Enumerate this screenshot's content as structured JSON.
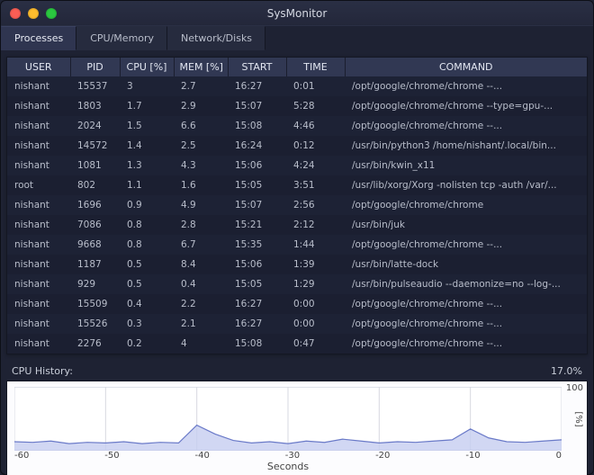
{
  "window": {
    "title": "SysMonitor"
  },
  "tabs": [
    {
      "label": "Processes",
      "active": true
    },
    {
      "label": "CPU/Memory",
      "active": false
    },
    {
      "label": "Network/Disks",
      "active": false
    }
  ],
  "table": {
    "headers": [
      "USER",
      "PID",
      "CPU [%]",
      "MEM [%]",
      "START",
      "TIME",
      "COMMAND"
    ],
    "rows": [
      {
        "user": "nishant",
        "pid": "15537",
        "cpu": "3",
        "mem": "2.7",
        "start": "16:27",
        "time": "0:01",
        "cmd": "/opt/google/chrome/chrome --..."
      },
      {
        "user": "nishant",
        "pid": "1803",
        "cpu": "1.7",
        "mem": "2.9",
        "start": "15:07",
        "time": "5:28",
        "cmd": "/opt/google/chrome/chrome --type=gpu-..."
      },
      {
        "user": "nishant",
        "pid": "2024",
        "cpu": "1.5",
        "mem": "6.6",
        "start": "15:08",
        "time": "4:46",
        "cmd": "/opt/google/chrome/chrome --..."
      },
      {
        "user": "nishant",
        "pid": "14572",
        "cpu": "1.4",
        "mem": "2.5",
        "start": "16:24",
        "time": "0:12",
        "cmd": "/usr/bin/python3 /home/nishant/.local/bin..."
      },
      {
        "user": "nishant",
        "pid": "1081",
        "cpu": "1.3",
        "mem": "4.3",
        "start": "15:06",
        "time": "4:24",
        "cmd": "/usr/bin/kwin_x11"
      },
      {
        "user": "root",
        "pid": "802",
        "cpu": "1.1",
        "mem": "1.6",
        "start": "15:05",
        "time": "3:51",
        "cmd": "/usr/lib/xorg/Xorg -nolisten tcp -auth /var/..."
      },
      {
        "user": "nishant",
        "pid": "1696",
        "cpu": "0.9",
        "mem": "4.9",
        "start": "15:07",
        "time": "2:56",
        "cmd": "/opt/google/chrome/chrome"
      },
      {
        "user": "nishant",
        "pid": "7086",
        "cpu": "0.8",
        "mem": "2.8",
        "start": "15:21",
        "time": "2:12",
        "cmd": "/usr/bin/juk"
      },
      {
        "user": "nishant",
        "pid": "9668",
        "cpu": "0.8",
        "mem": "6.7",
        "start": "15:35",
        "time": "1:44",
        "cmd": "/opt/google/chrome/chrome --..."
      },
      {
        "user": "nishant",
        "pid": "1187",
        "cpu": "0.5",
        "mem": "8.4",
        "start": "15:06",
        "time": "1:39",
        "cmd": "/usr/bin/latte-dock"
      },
      {
        "user": "nishant",
        "pid": "929",
        "cpu": "0.5",
        "mem": "0.4",
        "start": "15:05",
        "time": "1:29",
        "cmd": "/usr/bin/pulseaudio --daemonize=no --log-..."
      },
      {
        "user": "nishant",
        "pid": "15509",
        "cpu": "0.4",
        "mem": "2.2",
        "start": "16:27",
        "time": "0:00",
        "cmd": "/opt/google/chrome/chrome --..."
      },
      {
        "user": "nishant",
        "pid": "15526",
        "cpu": "0.3",
        "mem": "2.1",
        "start": "16:27",
        "time": "0:00",
        "cmd": "/opt/google/chrome/chrome --..."
      },
      {
        "user": "nishant",
        "pid": "2276",
        "cpu": "0.2",
        "mem": "4",
        "start": "15:08",
        "time": "0:47",
        "cmd": "/opt/google/chrome/chrome --..."
      }
    ]
  },
  "cpu_history": {
    "label": "CPU History:",
    "value_label": "17.0%"
  },
  "chart_data": {
    "type": "area",
    "title": "CPU History",
    "xlabel": "Seconds",
    "ylabel": "[%]",
    "xlim": [
      -60,
      0
    ],
    "ylim": [
      0,
      100
    ],
    "xticks": [
      -60,
      -50,
      -40,
      -30,
      -20,
      -10,
      0
    ],
    "yticks": [
      100
    ],
    "x": [
      -60,
      -58,
      -56,
      -54,
      -52,
      -50,
      -48,
      -46,
      -44,
      -42,
      -40,
      -38,
      -36,
      -34,
      -32,
      -30,
      -28,
      -26,
      -24,
      -22,
      -20,
      -18,
      -16,
      -14,
      -12,
      -10,
      -8,
      -6,
      -4,
      -2,
      0
    ],
    "values": [
      14,
      13,
      15,
      11,
      13,
      12,
      14,
      11,
      13,
      12,
      40,
      26,
      16,
      12,
      14,
      11,
      15,
      13,
      18,
      15,
      12,
      14,
      13,
      15,
      17,
      34,
      20,
      14,
      13,
      15,
      17
    ],
    "color": "#6a7ac8",
    "fill": "#c5cdf0"
  }
}
